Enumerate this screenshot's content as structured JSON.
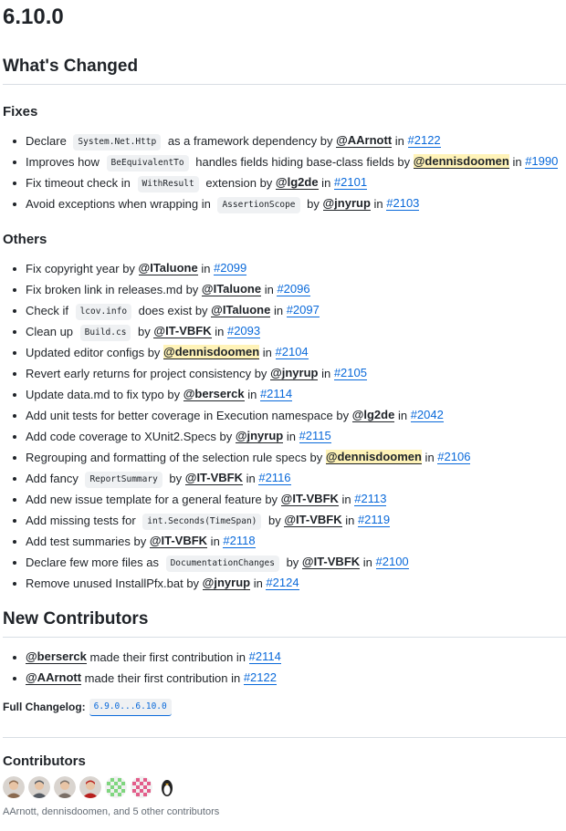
{
  "release": {
    "version": "6.10.0"
  },
  "whats_changed": {
    "heading": "What's Changed",
    "fixes": {
      "heading": "Fixes",
      "items": [
        [
          {
            "t": "text",
            "v": "Declare "
          },
          {
            "t": "code",
            "v": "System.Net.Http"
          },
          {
            "t": "text",
            "v": " as a framework dependency by "
          },
          {
            "t": "user",
            "v": "@AArnott"
          },
          {
            "t": "text",
            "v": " in "
          },
          {
            "t": "pr",
            "v": "#2122"
          }
        ],
        [
          {
            "t": "text",
            "v": "Improves how "
          },
          {
            "t": "code",
            "v": "BeEquivalentTo"
          },
          {
            "t": "text",
            "v": " handles fields hiding base-class fields by "
          },
          {
            "t": "userhl",
            "v": "@dennisdoomen"
          },
          {
            "t": "text",
            "v": " in "
          },
          {
            "t": "pr",
            "v": "#1990"
          }
        ],
        [
          {
            "t": "text",
            "v": "Fix timeout check in "
          },
          {
            "t": "code",
            "v": "WithResult"
          },
          {
            "t": "text",
            "v": " extension by "
          },
          {
            "t": "user",
            "v": "@lg2de"
          },
          {
            "t": "text",
            "v": " in "
          },
          {
            "t": "pr",
            "v": "#2101"
          }
        ],
        [
          {
            "t": "text",
            "v": "Avoid exceptions when wrapping in "
          },
          {
            "t": "code",
            "v": "AssertionScope"
          },
          {
            "t": "text",
            "v": " by "
          },
          {
            "t": "user",
            "v": "@jnyrup"
          },
          {
            "t": "text",
            "v": " in "
          },
          {
            "t": "pr",
            "v": "#2103"
          }
        ]
      ]
    },
    "others": {
      "heading": "Others",
      "items": [
        [
          {
            "t": "text",
            "v": "Fix copyright year by "
          },
          {
            "t": "user",
            "v": "@ITaluone"
          },
          {
            "t": "text",
            "v": " in "
          },
          {
            "t": "pr",
            "v": "#2099"
          }
        ],
        [
          {
            "t": "text",
            "v": "Fix broken link in releases.md by "
          },
          {
            "t": "user",
            "v": "@ITaluone"
          },
          {
            "t": "text",
            "v": " in "
          },
          {
            "t": "pr",
            "v": "#2096"
          }
        ],
        [
          {
            "t": "text",
            "v": "Check if "
          },
          {
            "t": "code",
            "v": "lcov.info"
          },
          {
            "t": "text",
            "v": " does exist by "
          },
          {
            "t": "user",
            "v": "@ITaluone"
          },
          {
            "t": "text",
            "v": " in "
          },
          {
            "t": "pr",
            "v": "#2097"
          }
        ],
        [
          {
            "t": "text",
            "v": "Clean up "
          },
          {
            "t": "code",
            "v": "Build.cs"
          },
          {
            "t": "text",
            "v": " by "
          },
          {
            "t": "user",
            "v": "@IT-VBFK"
          },
          {
            "t": "text",
            "v": " in "
          },
          {
            "t": "pr",
            "v": "#2093"
          }
        ],
        [
          {
            "t": "text",
            "v": "Updated editor configs by "
          },
          {
            "t": "userhl",
            "v": "@dennisdoomen"
          },
          {
            "t": "text",
            "v": " in "
          },
          {
            "t": "pr",
            "v": "#2104"
          }
        ],
        [
          {
            "t": "text",
            "v": "Revert early returns for project consistency by "
          },
          {
            "t": "user",
            "v": "@jnyrup"
          },
          {
            "t": "text",
            "v": " in "
          },
          {
            "t": "pr",
            "v": "#2105"
          }
        ],
        [
          {
            "t": "text",
            "v": "Update data.md to fix typo by "
          },
          {
            "t": "user",
            "v": "@berserck"
          },
          {
            "t": "text",
            "v": " in "
          },
          {
            "t": "pr",
            "v": "#2114"
          }
        ],
        [
          {
            "t": "text",
            "v": "Add unit tests for better coverage in Execution namespace by "
          },
          {
            "t": "user",
            "v": "@lg2de"
          },
          {
            "t": "text",
            "v": " in "
          },
          {
            "t": "pr",
            "v": "#2042"
          }
        ],
        [
          {
            "t": "text",
            "v": "Add code coverage to XUnit2.Specs by "
          },
          {
            "t": "user",
            "v": "@jnyrup"
          },
          {
            "t": "text",
            "v": " in "
          },
          {
            "t": "pr",
            "v": "#2115"
          }
        ],
        [
          {
            "t": "text",
            "v": "Regrouping and formatting of the selection rule specs by "
          },
          {
            "t": "userhl",
            "v": "@dennisdoomen"
          },
          {
            "t": "text",
            "v": " in "
          },
          {
            "t": "pr",
            "v": "#2106"
          }
        ],
        [
          {
            "t": "text",
            "v": "Add fancy "
          },
          {
            "t": "code",
            "v": "ReportSummary"
          },
          {
            "t": "text",
            "v": " by "
          },
          {
            "t": "user",
            "v": "@IT-VBFK"
          },
          {
            "t": "text",
            "v": " in "
          },
          {
            "t": "pr",
            "v": "#2116"
          }
        ],
        [
          {
            "t": "text",
            "v": "Add new issue template for a general feature by "
          },
          {
            "t": "user",
            "v": "@IT-VBFK"
          },
          {
            "t": "text",
            "v": " in "
          },
          {
            "t": "pr",
            "v": "#2113"
          }
        ],
        [
          {
            "t": "text",
            "v": "Add missing tests for "
          },
          {
            "t": "code",
            "v": "int.Seconds(TimeSpan)"
          },
          {
            "t": "text",
            "v": " by "
          },
          {
            "t": "user",
            "v": "@IT-VBFK"
          },
          {
            "t": "text",
            "v": " in "
          },
          {
            "t": "pr",
            "v": "#2119"
          }
        ],
        [
          {
            "t": "text",
            "v": "Add test summaries by "
          },
          {
            "t": "user",
            "v": "@IT-VBFK"
          },
          {
            "t": "text",
            "v": " in "
          },
          {
            "t": "pr",
            "v": "#2118"
          }
        ],
        [
          {
            "t": "text",
            "v": "Declare few more files as "
          },
          {
            "t": "code",
            "v": "DocumentationChanges"
          },
          {
            "t": "text",
            "v": " by "
          },
          {
            "t": "user",
            "v": "@IT-VBFK"
          },
          {
            "t": "text",
            "v": " in "
          },
          {
            "t": "pr",
            "v": "#2100"
          }
        ],
        [
          {
            "t": "text",
            "v": "Remove unused InstallPfx.bat by "
          },
          {
            "t": "user",
            "v": "@jnyrup"
          },
          {
            "t": "text",
            "v": " in "
          },
          {
            "t": "pr",
            "v": "#2124"
          }
        ]
      ]
    }
  },
  "new_contributors": {
    "heading": "New Contributors",
    "items": [
      [
        {
          "t": "user",
          "v": "@berserck"
        },
        {
          "t": "text",
          "v": " made their first contribution in "
        },
        {
          "t": "pr",
          "v": "#2114"
        }
      ],
      [
        {
          "t": "user",
          "v": "@AArnott"
        },
        {
          "t": "text",
          "v": " made their first contribution in "
        },
        {
          "t": "pr",
          "v": "#2122"
        }
      ]
    ]
  },
  "full_changelog": {
    "label": "Full Changelog:",
    "range": "6.9.0...6.10.0"
  },
  "contributors": {
    "heading": "Contributors",
    "avatars": [
      {
        "name": "avatar-portrait-icon",
        "color": "#8a6a50"
      },
      {
        "name": "avatar-portrait-icon",
        "color": "#555b63"
      },
      {
        "name": "avatar-portrait-icon",
        "color": "#7a6f66"
      },
      {
        "name": "avatar-portrait-icon",
        "color": "#b8201e"
      },
      {
        "name": "identicon-icon",
        "color": "#7fd67f"
      },
      {
        "name": "identicon-icon",
        "color": "#e35d8a"
      },
      {
        "name": "penguin-icon",
        "color": "#222222"
      }
    ],
    "summary": "AArnott, dennisdoomen, and 5 other contributors"
  }
}
